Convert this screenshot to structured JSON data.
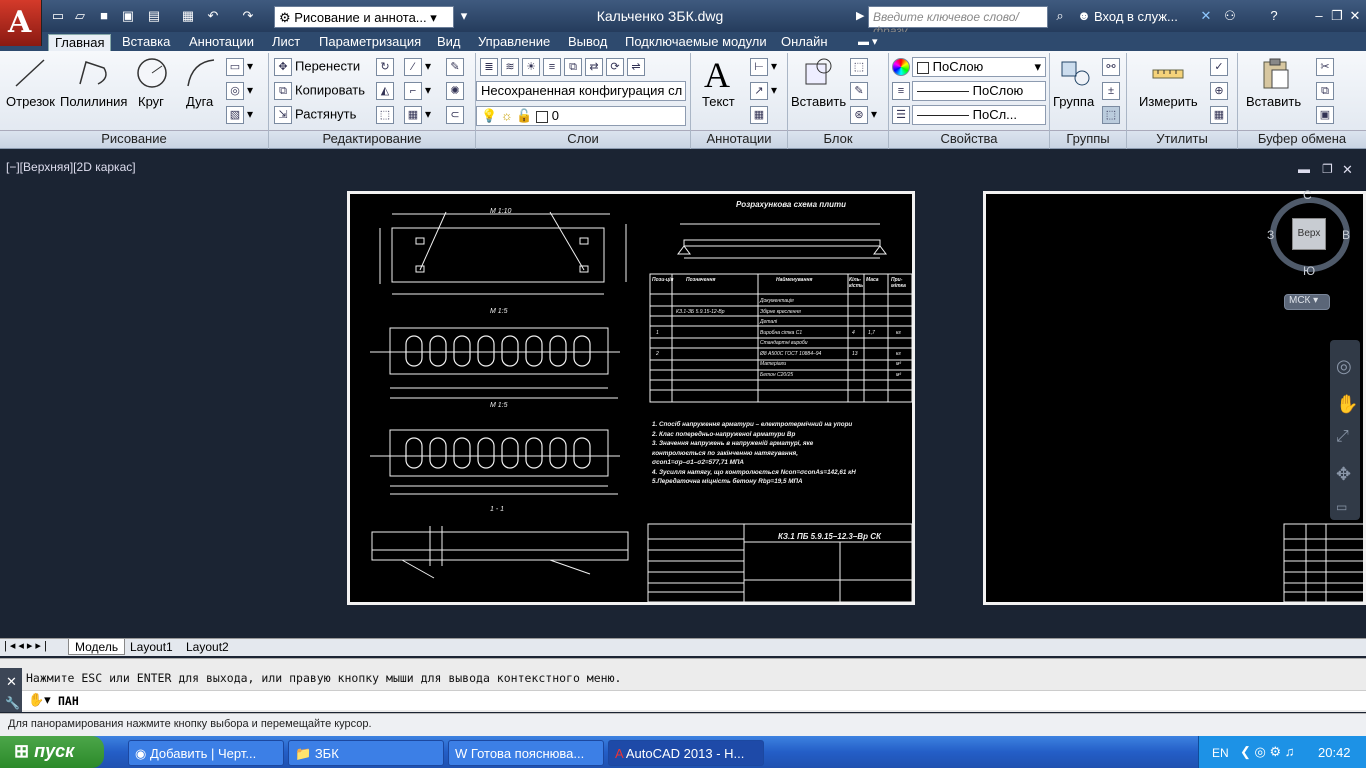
{
  "titlebar": {
    "app_letter": "A",
    "workspace": "Рисование и аннота...",
    "title": "Кальченко ЗБК.dwg",
    "search_placeholder": "Введите ключевое слово/фразу",
    "signin": "Вход в служ...",
    "help": "?"
  },
  "ribbon_tabs": [
    "Главная",
    "Вставка",
    "Аннотации",
    "Лист",
    "Параметризация",
    "Вид",
    "Управление",
    "Вывод",
    "Подключаемые модули",
    "Онлайн"
  ],
  "draw_panel": {
    "title": "Рисование",
    "line": "Отрезок",
    "polyline": "Полилиния",
    "circle": "Круг",
    "arc": "Дуга"
  },
  "modify_panel": {
    "title": "Редактирование",
    "move": "Перенести",
    "copy": "Копировать",
    "stretch": "Растянуть"
  },
  "layers_panel": {
    "title": "Слои",
    "state": "Несохраненная конфигурация сл",
    "layer": "0"
  },
  "annotation_panel": {
    "title": "Аннотации",
    "text": "Текст"
  },
  "block_panel": {
    "title": "Блок",
    "insert": "Вставить"
  },
  "properties_panel": {
    "title": "Свойства",
    "color": "ПоСлою",
    "linetype": "ПоСлою",
    "lineweight": "ПоСл..."
  },
  "groups_panel": {
    "title": "Группы",
    "group": "Группа"
  },
  "utilities_panel": {
    "title": "Утилиты",
    "measure": "Измерить"
  },
  "clipboard_panel": {
    "title": "Буфер обмена",
    "paste": "Вставить"
  },
  "viewport": {
    "label": "[−][Верхняя][2D каркас]"
  },
  "drawing": {
    "title_main": "Розрахункова схема плити",
    "section_a": "М 1:10",
    "section_b": "М 1:5",
    "section_c": "М 1:5",
    "section_d": "1 - 1",
    "stamp_code": "КЗ.1 ПБ 5.9.15–12.3–Вр СК",
    "notes": [
      "1. Спосіб напруження арматури – електротермічний на упори",
      "2. Клас попередньо-напруженої арматури Вр",
      "3. Значення напружень в напруженій арматурі, яке",
      "контролюється по закінченню натягування,",
      "σcon1=σp–σ1–σ2=577,71 МПА",
      "4. Зусилля натягу, що контролюється Ncon=σconAs=142,61 кН",
      "5.Передаточна міцність бетону Rbp=19,5 МПА"
    ],
    "spec_headers": [
      "Пози-ція",
      "Позначення",
      "Найменування",
      "Кіль-кість",
      "Маса",
      "При-мітка"
    ],
    "spec_rows": [
      [
        "",
        "",
        "Документація",
        "",
        "",
        ""
      ],
      [
        "",
        "КЗ.1-ЗБ 5.9.15-12-Вр",
        "Збірне креслення",
        "",
        "",
        ""
      ],
      [
        "",
        "",
        "Деталі",
        "",
        "",
        ""
      ],
      [
        "1",
        "",
        "Виробна сітка С1",
        "4",
        "1,7",
        "кг"
      ],
      [
        "",
        "",
        "Стандартні вироби",
        "",
        "",
        ""
      ],
      [
        "2",
        "",
        "Ø8 А500С ГОСТ 10884–94",
        "13",
        "",
        "кг"
      ],
      [
        "",
        "",
        "Матеріали",
        "",
        "",
        "м³"
      ],
      [
        "",
        "",
        "Бетон С20/25",
        "",
        "",
        "м³"
      ]
    ]
  },
  "viewcube": {
    "north": "С",
    "south": "Ю",
    "west": "З",
    "east": "В",
    "top": "Верх",
    "ucs": "МСК"
  },
  "layout_tabs": [
    "Модель",
    "Layout1",
    "Layout2"
  ],
  "command": {
    "history": "Нажмите ESC или ENTER для выхода, или правую кнопку мыши для вывода контекстного меню.",
    "prompt": "ПАН"
  },
  "status": "Для панорамирования нажмите кнопку выбора и перемещайте курсор.",
  "taskbar": {
    "start": "пуск",
    "tasks": [
      "Добавить | Черт...",
      "ЗБК",
      "Готова пояснюва...",
      "AutoCAD 2013 - Н..."
    ],
    "lang": "EN",
    "clock": "20:42"
  }
}
